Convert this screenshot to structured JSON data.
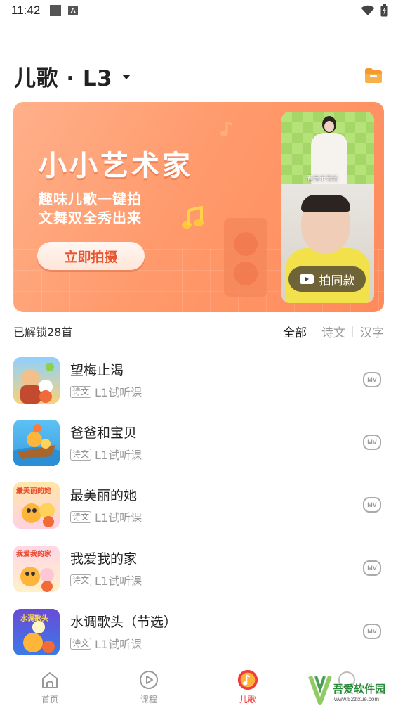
{
  "status_bar": {
    "time": "11:42",
    "notification_icon_letter": "A"
  },
  "header": {
    "title": "儿歌 · L3"
  },
  "banner": {
    "title": "小小艺术家",
    "subtitle_line1": "趣味儿歌一键拍",
    "subtitle_line2": "文舞双全秀出来",
    "cta_label": "立即拍摄",
    "video_caption": "看完示范后",
    "shoot_same_label": "拍同款",
    "colors": {
      "accent": "#ff8a5a",
      "cta_text": "#e8552f"
    }
  },
  "library": {
    "unlocked_label": "已解锁28首",
    "filters": [
      {
        "label": "全部",
        "active": true
      },
      {
        "label": "诗文",
        "active": false
      },
      {
        "label": "汉字",
        "active": false
      }
    ]
  },
  "songs": [
    {
      "title": "望梅止渴",
      "tag": "诗文",
      "level": "L1试听课",
      "mv_label": "MV",
      "thumb_text": ""
    },
    {
      "title": "爸爸和宝贝",
      "tag": "诗文",
      "level": "L1试听课",
      "mv_label": "MV",
      "thumb_text": ""
    },
    {
      "title": "最美丽的她",
      "tag": "诗文",
      "level": "L1试听课",
      "mv_label": "MV",
      "thumb_text": "最美丽的她"
    },
    {
      "title": "我爱我的家",
      "tag": "诗文",
      "level": "L1试听课",
      "mv_label": "MV",
      "thumb_text": "我爱我的家"
    },
    {
      "title": "水调歌头（节选）",
      "tag": "诗文",
      "level": "L1试听课",
      "mv_label": "MV",
      "thumb_text": "水调歌头"
    }
  ],
  "tab_bar": {
    "tabs": [
      {
        "label": "首页",
        "icon": "home-icon",
        "active": false
      },
      {
        "label": "课程",
        "icon": "play-circle-icon",
        "active": false
      },
      {
        "label": "儿歌",
        "icon": "music-note-icon",
        "active": true
      },
      {
        "label": "",
        "icon": "profile-icon",
        "active": false
      }
    ],
    "active_color": "#f03c3c"
  },
  "watermark": {
    "brand": "吾爱软件园",
    "url": "www.52zixue.com"
  }
}
